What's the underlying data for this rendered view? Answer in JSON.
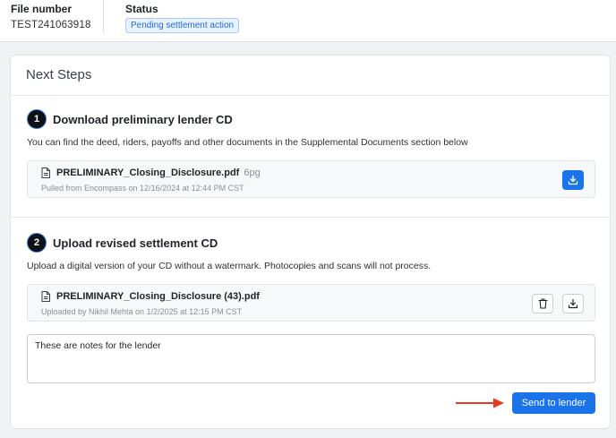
{
  "header": {
    "file_number_label": "File number",
    "file_number_value": "TEST241063918",
    "status_label": "Status",
    "status_badge": "Pending settlement action"
  },
  "card": {
    "title": "Next Steps"
  },
  "step1": {
    "number": "1",
    "title": "Download preliminary lender CD",
    "description": "You can find the deed, riders, payoffs and other documents in the Supplemental Documents section below",
    "file": {
      "name": "PRELIMINARY_Closing_Disclosure.pdf",
      "pages": "6pg",
      "meta": "Pulled from Encompass on 12/16/2024 at 12:44 PM CST",
      "icon": "document-icon",
      "download_icon": "download-icon"
    }
  },
  "step2": {
    "number": "2",
    "title": "Upload revised settlement CD",
    "description": "Upload a digital version of your CD without a watermark. Photocopies and scans will not process.",
    "file": {
      "name": "PRELIMINARY_Closing_Disclosure (43).pdf",
      "meta": "Uploaded by Nikhil Mehta on 1/2/2025 at 12:15 PM CST",
      "icon": "document-icon",
      "delete_icon": "trash-icon",
      "download_icon": "download-icon"
    },
    "notes_value": "These are notes for the lender",
    "send_label": "Send to lender"
  },
  "colors": {
    "primary": "#1a73e8",
    "badge_bg": "#e8f1fd",
    "badge_text": "#1d6fd6",
    "arrow": "#e53a1e",
    "step_circle": "#0f1115"
  }
}
